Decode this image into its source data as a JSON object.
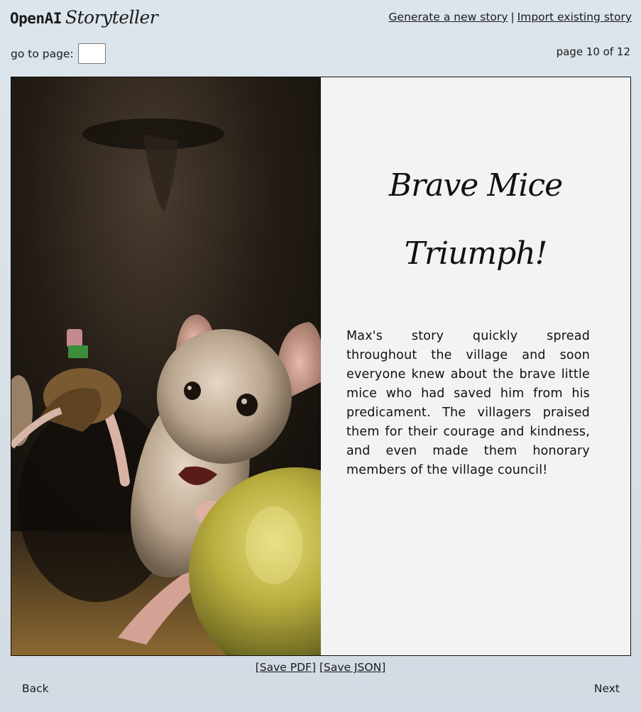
{
  "brand": {
    "openai": "OpenAI",
    "storyteller": "Storyteller"
  },
  "header": {
    "generate_link": "Generate a new story",
    "separator": "|",
    "import_link": "Import existing story",
    "goto_label": "go to page:",
    "goto_value": "",
    "page_info": "page 10 of 12"
  },
  "page": {
    "title_line1": "Brave Mice",
    "title_line2": "Triumph!",
    "body": "Max's story quickly spread throughout the village and soon everyone knew about the brave little mice who had saved him from his predicament. The villagers praised them for their courage and kindness, and even made them honorary members of the village council!"
  },
  "footer": {
    "save_pdf_open": "[",
    "save_pdf": "Save PDF",
    "save_pdf_close": "]",
    "save_json_open": "[",
    "save_json": "Save JSON",
    "save_json_close": "]",
    "back": "Back",
    "next": "Next"
  }
}
